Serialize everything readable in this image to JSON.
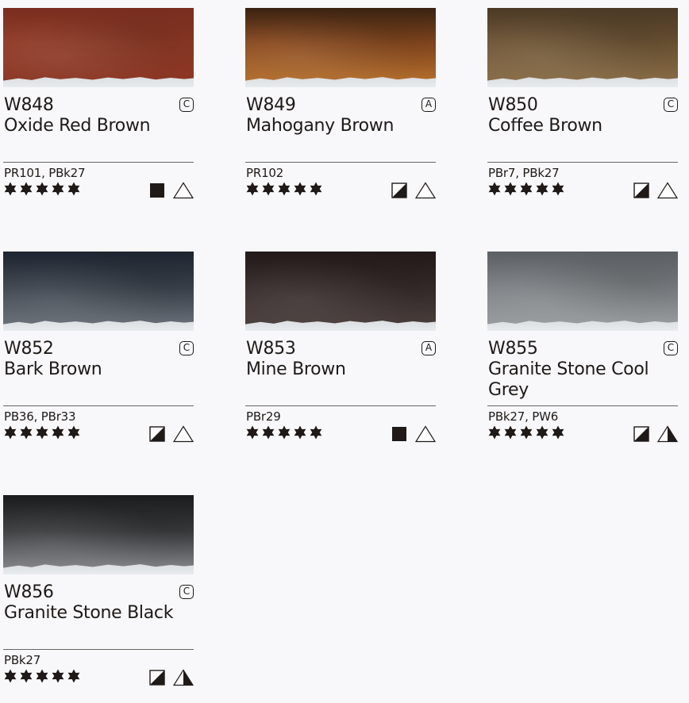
{
  "colors": [
    {
      "code": "W848",
      "name": "Oxide Red Brown",
      "grade": "C",
      "pigments": "PR101, PBk27",
      "stars": 5,
      "opacity": "opaque",
      "staining": "non-staining",
      "swatch_colors": [
        "#7a2e1f",
        "#8f3a26",
        "#8a3523"
      ]
    },
    {
      "code": "W849",
      "name": "Mahogany Brown",
      "grade": "A",
      "pigments": "PR102",
      "stars": 5,
      "opacity": "semi-opaque",
      "staining": "non-staining",
      "swatch_colors": [
        "#3a2212",
        "#8a4a1f",
        "#b8722e"
      ]
    },
    {
      "code": "W850",
      "name": "Coffee Brown",
      "grade": "C",
      "pigments": "PBr7, PBk27",
      "stars": 5,
      "opacity": "semi-opaque",
      "staining": "non-staining",
      "swatch_colors": [
        "#4b3a26",
        "#6f5535",
        "#8a6e48"
      ]
    },
    {
      "code": "W852",
      "name": "Bark Brown",
      "grade": "C",
      "pigments": "PB36, PBr33",
      "stars": 5,
      "opacity": "semi-opaque",
      "staining": "non-staining",
      "swatch_colors": [
        "#1e2530",
        "#3c434d",
        "#6e747c"
      ]
    },
    {
      "code": "W853",
      "name": "Mine Brown",
      "grade": "A",
      "pigments": "PBr29",
      "stars": 5,
      "opacity": "opaque",
      "staining": "non-staining",
      "swatch_colors": [
        "#221a19",
        "#362b2a",
        "#4b403e"
      ]
    },
    {
      "code": "W855",
      "name": "Granite Stone Cool Grey",
      "grade": "C",
      "pigments": "PBk27, PW6",
      "stars": 5,
      "opacity": "semi-opaque",
      "staining": "semi-staining",
      "swatch_colors": [
        "#5c6064",
        "#7c8084",
        "#9b9ea1"
      ]
    },
    {
      "code": "W856",
      "name": "Granite Stone Black",
      "grade": "C",
      "pigments": "PBk27",
      "stars": 5,
      "opacity": "semi-opaque",
      "staining": "semi-staining",
      "swatch_colors": [
        "#1b1c1e",
        "#3a3b3d",
        "#8b8d90"
      ]
    }
  ]
}
